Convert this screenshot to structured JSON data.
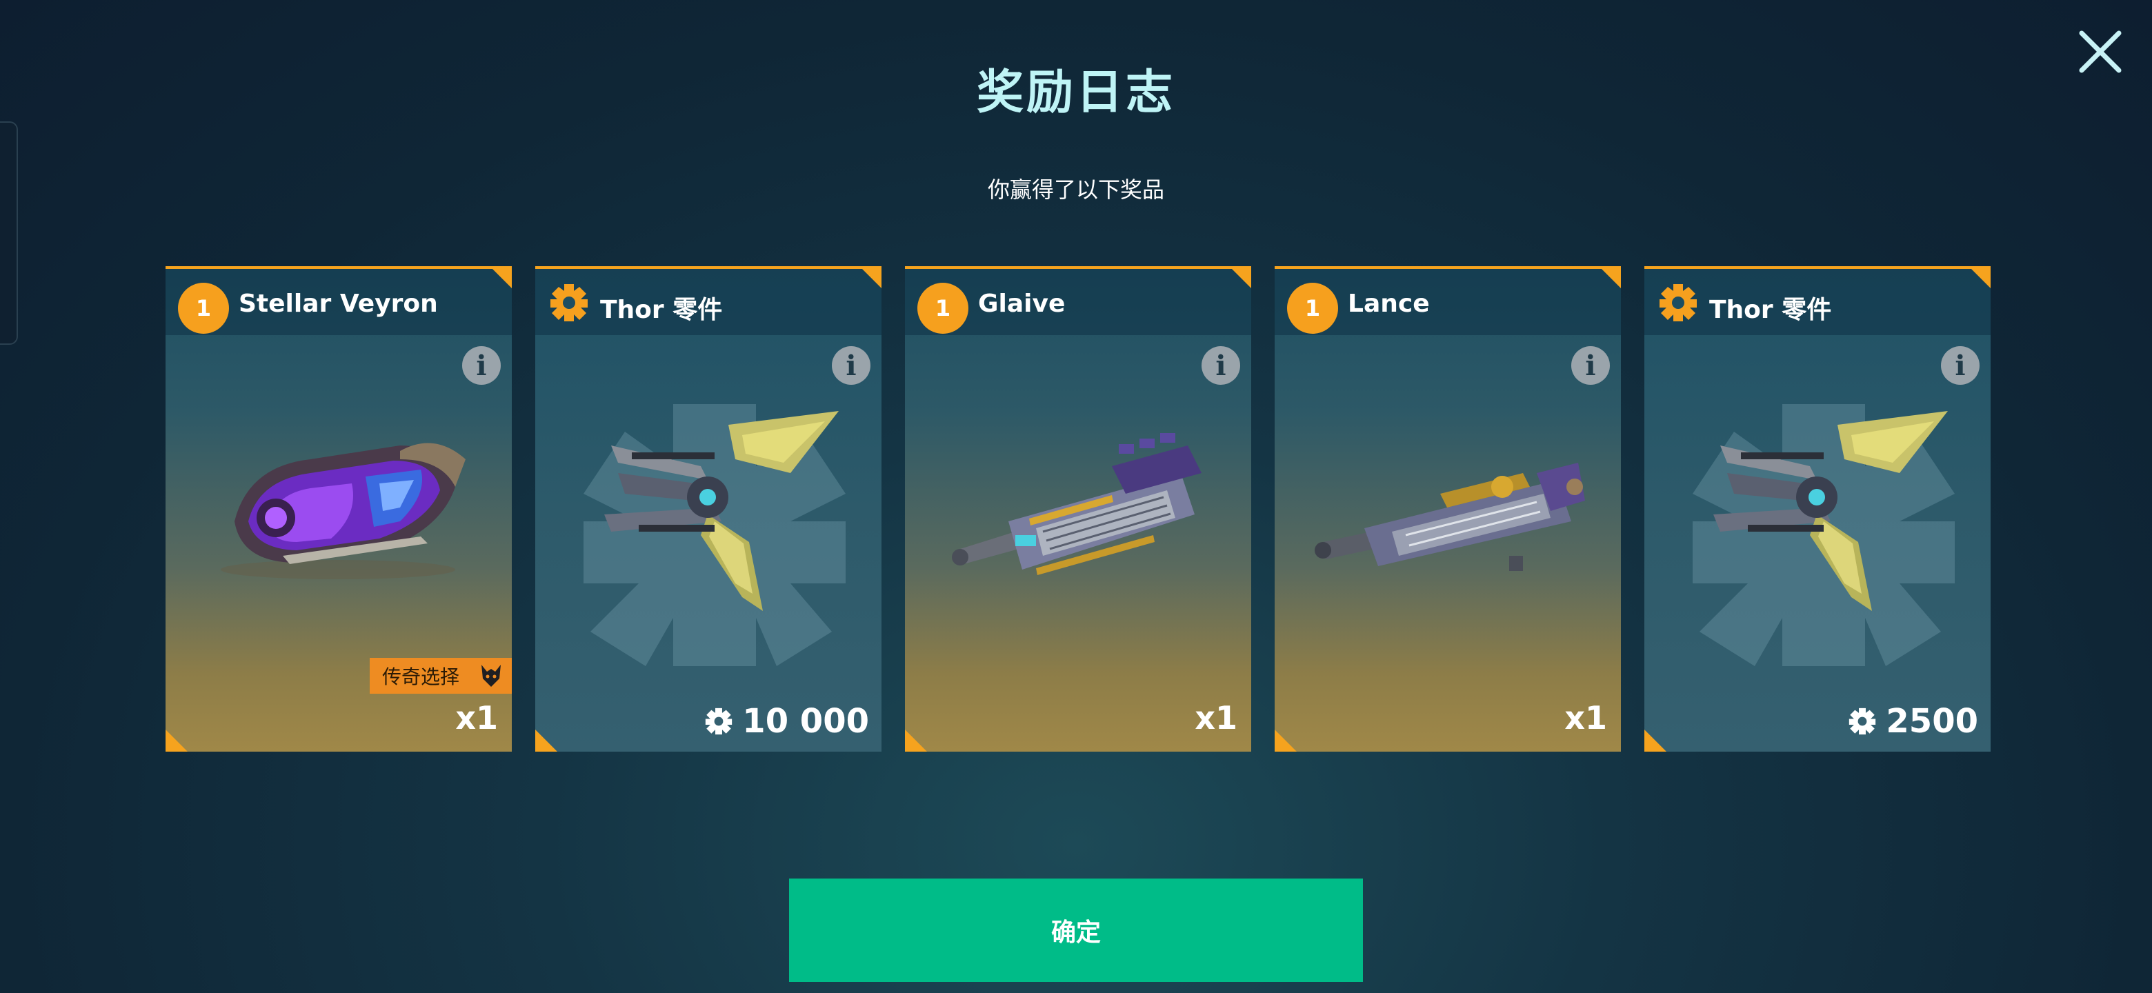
{
  "dialog": {
    "title": "奖励日志",
    "subtitle": "你赢得了以下奖品",
    "confirm_label": "确定"
  },
  "rewards": [
    {
      "name": "Stellar Veyron",
      "badge": "1",
      "icon": "tier-badge",
      "quantity": "x1",
      "tag": "传奇选择",
      "art": "purple-drone"
    },
    {
      "name": "Thor 零件",
      "icon": "parts-icon",
      "amount": "10 000",
      "art": "thor-robot-parts"
    },
    {
      "name": "Glaive",
      "badge": "1",
      "icon": "tier-badge",
      "quantity": "x1",
      "art": "glaive-weapon"
    },
    {
      "name": "Lance",
      "badge": "1",
      "icon": "tier-badge",
      "quantity": "x1",
      "art": "lance-weapon"
    },
    {
      "name": "Thor 零件",
      "icon": "parts-icon",
      "amount": "2500",
      "art": "thor-robot-parts"
    }
  ],
  "colors": {
    "accent_orange": "#f6a31e",
    "confirm_green": "#00bc88",
    "title_cyan": "#bff4f6"
  }
}
